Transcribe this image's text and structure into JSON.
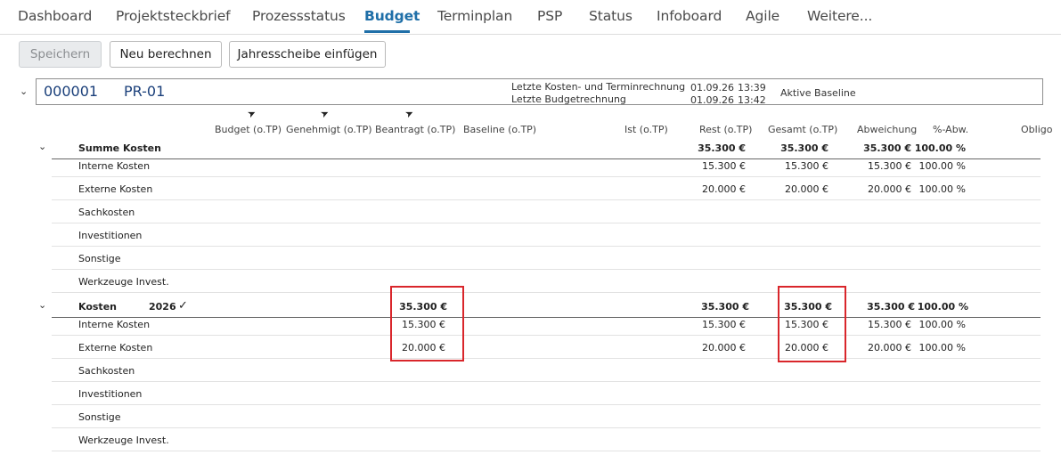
{
  "tabs": [
    {
      "label": "Dashboard"
    },
    {
      "label": "Projektsteckbrief"
    },
    {
      "label": "Prozessstatus"
    },
    {
      "label": "Budget"
    },
    {
      "label": "Terminplan"
    },
    {
      "label": "PSP"
    },
    {
      "label": "Status"
    },
    {
      "label": "Infoboard"
    },
    {
      "label": "Agile"
    },
    {
      "label": "Weitere..."
    }
  ],
  "toolbar": {
    "save": "Speichern",
    "recalc": "Neu berechnen",
    "insert_year": "Jahresscheibe einfügen"
  },
  "project": {
    "number": "000001",
    "code": "PR-01",
    "last_cost_label": "Letzte Kosten- und Terminrechnung",
    "last_budget_label": "Letzte Budgetrechnung",
    "last_cost_date": "01.09.26",
    "last_cost_time": "13:39",
    "last_budget_date": "01.09.26",
    "last_budget_time": "13:42",
    "baseline": "Aktive Baseline"
  },
  "columns": {
    "budget": "Budget (o.TP)",
    "approved": "Genehmigt (o.TP)",
    "requested": "Beantragt (o.TP)",
    "baseline": "Baseline (o.TP)",
    "actual": "Ist (o.TP)",
    "rest": "Rest (o.TP)",
    "total": "Gesamt (o.TP)",
    "deviation": "Abweichung",
    "pct_dev": "%-Abw.",
    "obligo": "Obligo"
  },
  "summary": {
    "label": "Summe Kosten",
    "rest": "35.300 €",
    "total": "35.300 €",
    "deviation": "35.300 €",
    "pct": "100.00 %",
    "rows": [
      {
        "label": "Interne Kosten",
        "rest": "15.300 €",
        "total": "15.300 €",
        "deviation": "15.300 €",
        "pct": "100.00 %"
      },
      {
        "label": "Externe Kosten",
        "rest": "20.000 €",
        "total": "20.000 €",
        "deviation": "20.000 €",
        "pct": "100.00 %"
      },
      {
        "label": "Sachkosten"
      },
      {
        "label": "Investitionen"
      },
      {
        "label": "Sonstige"
      },
      {
        "label": "Werkzeuge Invest."
      }
    ]
  },
  "year_group": {
    "label": "Kosten",
    "year": "2026",
    "requested": "35.300 €",
    "rest": "35.300 €",
    "total": "35.300 €",
    "deviation": "35.300 €",
    "pct": "100.00 %",
    "rows": [
      {
        "label": "Interne Kosten",
        "requested": "15.300 €",
        "rest": "15.300 €",
        "total": "15.300 €",
        "deviation": "15.300 €",
        "pct": "100.00 %"
      },
      {
        "label": "Externe Kosten",
        "requested": "20.000 €",
        "rest": "20.000 €",
        "total": "20.000 €",
        "deviation": "20.000 €",
        "pct": "100.00 %"
      },
      {
        "label": "Sachkosten"
      },
      {
        "label": "Investitionen"
      },
      {
        "label": "Sonstige"
      },
      {
        "label": "Werkzeuge Invest."
      }
    ]
  },
  "colors": {
    "accent": "#1f6fa8",
    "highlight": "#d9262b"
  }
}
